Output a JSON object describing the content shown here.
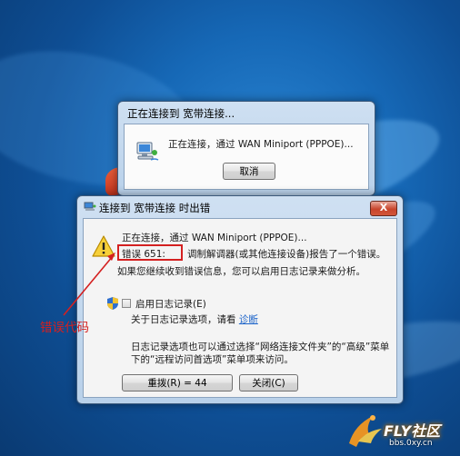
{
  "connecting_dialog": {
    "title": "正在连接到 宽带连接...",
    "status": "正在连接，通过 WAN Miniport (PPPOE)...",
    "cancel_label": "取消"
  },
  "error_dialog": {
    "title": "连接到 宽带连接 时出错",
    "close_glyph": "X",
    "line1": "正在连接，通过 WAN Miniport (PPPOE)...",
    "error_code": "错误 651:",
    "error_message": "调制解调器(或其他连接设备)报告了一个错误。",
    "line3": "如果您继续收到错误信息，您可以启用日志记录来做分析。",
    "enable_logging_label": "启用日志记录(E)",
    "about_logging_prefix": "关于日志记录选项，请看",
    "diagnose_link": "诊断",
    "note_line1": "日志记录选项也可以通过选择“网络连接文件夹”的“高级”菜单",
    "note_line2": "下的“远程访问首选项”菜单项来访问。",
    "redial_label": "重拨(R) = 44",
    "close_label": "关闭(C)"
  },
  "annotation": {
    "label": "错误代码",
    "color": "#d42020"
  },
  "watermark": {
    "brand": "FLY社区",
    "url": "bbs.0xy.cn"
  },
  "icons": [
    "network-computer-icon",
    "warning-icon",
    "uac-shield-icon",
    "close-icon"
  ],
  "colors": {
    "desktop": "#1668b6",
    "dialog_frame": "#b9d1ea",
    "close_button": "#c8452c",
    "annotation_red": "#d42020",
    "link": "#1c63c9"
  }
}
